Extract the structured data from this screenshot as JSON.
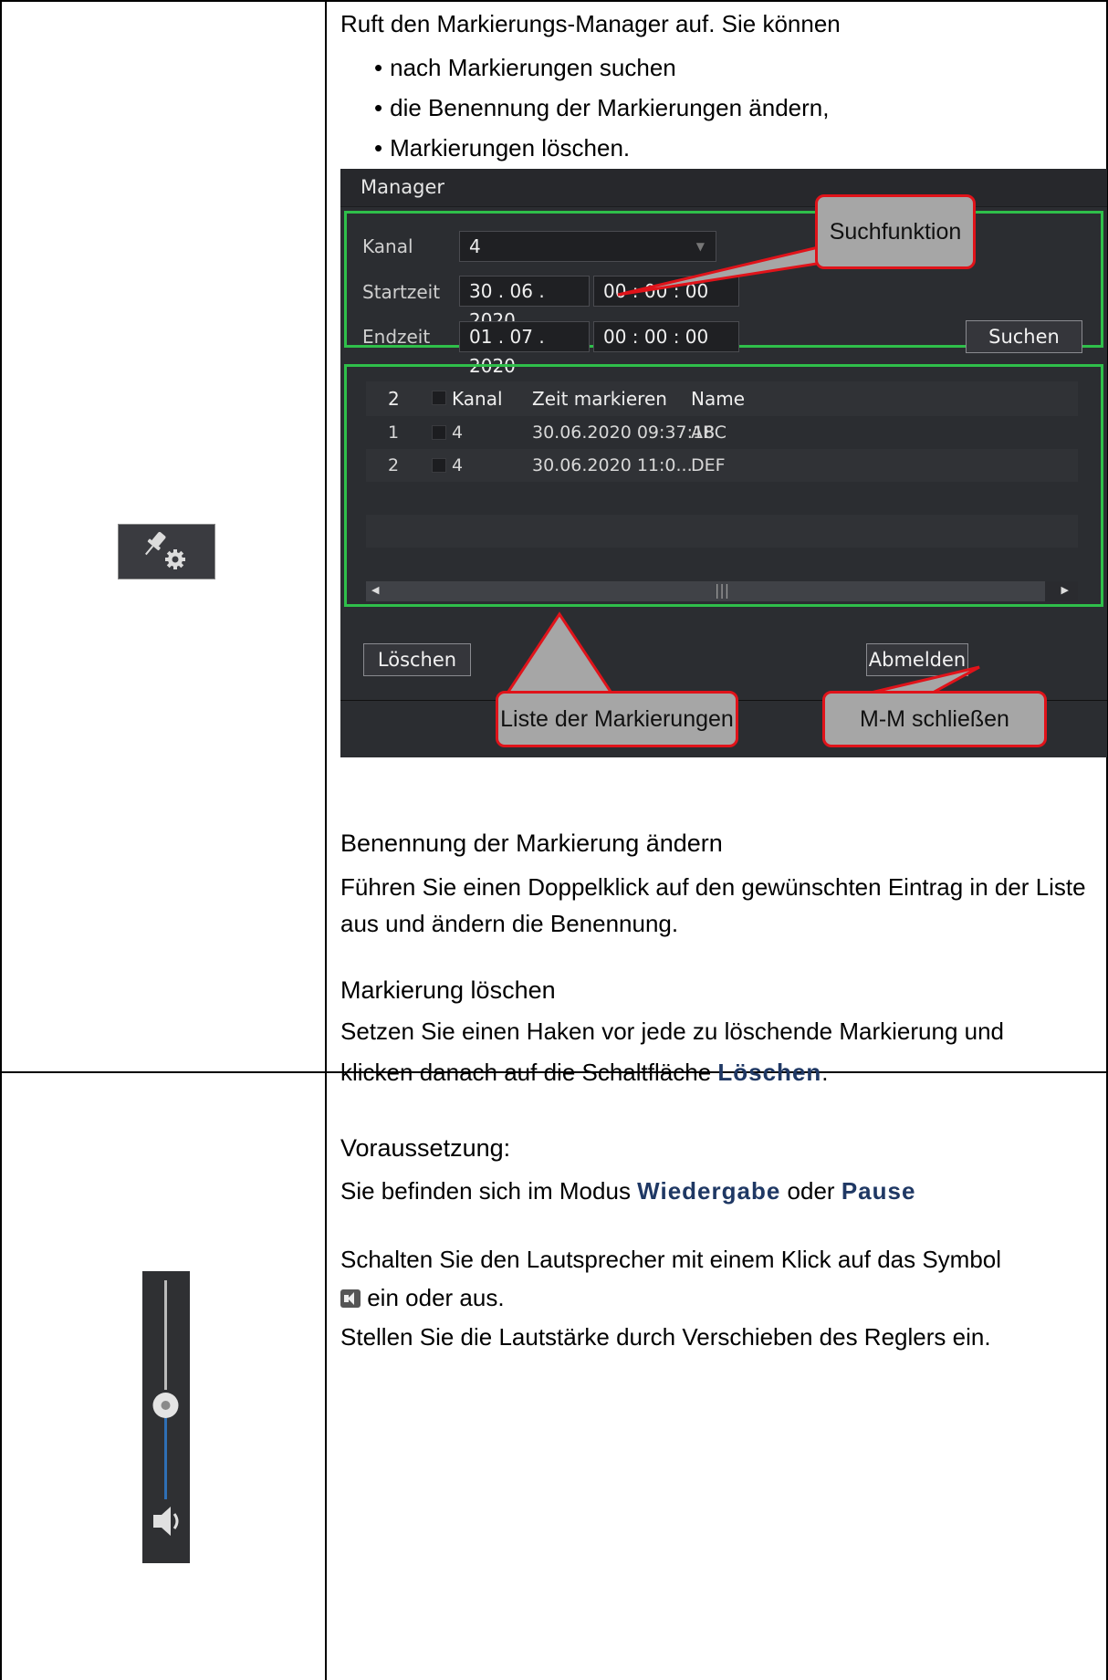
{
  "row1": {
    "intro": "Ruft den Markierungs-Manager auf. Sie können",
    "bullets": [
      "nach Markierungen suchen",
      "die Benennung der Markierungen ändern,",
      "Markierungen löschen."
    ],
    "manager": {
      "title": "Manager",
      "kanal_label": "Kanal",
      "kanal_value": "4",
      "startzeit_label": "Startzeit",
      "start_date": "30 . 06 . 2020",
      "start_time": "00 : 00 : 00",
      "endzeit_label": "Endzeit",
      "end_date": "01 . 07 . 2020",
      "end_time": "00 : 00 : 00",
      "search_button": "Suchen",
      "list_header": {
        "count": "2",
        "kanal": "Kanal",
        "zeit": "Zeit markieren",
        "name": "Name"
      },
      "rows": [
        {
          "no": "1",
          "kanal": "4",
          "zeit": "30.06.2020 09:37:18",
          "name": "ABC"
        },
        {
          "no": "2",
          "kanal": "4",
          "zeit": "30.06.2020 11:0...",
          "name": "DEF"
        }
      ],
      "delete_button": "Löschen",
      "logout_button": "Abmelden",
      "callout_search": "Suchfunktion",
      "callout_list": "Liste der Markierungen",
      "callout_close": "M-M schließen"
    },
    "heading_rename": "Benennung der Markierung ändern",
    "text_rename": "Führen Sie einen Doppelklick auf den gewünschten Eintrag in der Liste aus und ändern die Benennung.",
    "heading_delete": "Markierung löschen",
    "text_delete_1": "Setzen Sie einen Haken vor jede zu löschende Markierung und",
    "text_delete_2a": "klicken danach auf die Schaltfläche ",
    "text_delete_kw": "Löschen",
    "text_delete_2b": "."
  },
  "row2": {
    "heading": "Voraussetzung:",
    "cond_a": "Sie befinden sich im Modus ",
    "cond_kw1": "Wiedergabe",
    "cond_b": " oder ",
    "cond_kw2": "Pause",
    "speaker_a": "Schalten Sie den Lautsprecher mit einem Klick auf das Symbol",
    "speaker_b": " ein oder aus.",
    "volume_text": "Stellen Sie die Lautstärke durch Verschieben des Reglers ein."
  }
}
